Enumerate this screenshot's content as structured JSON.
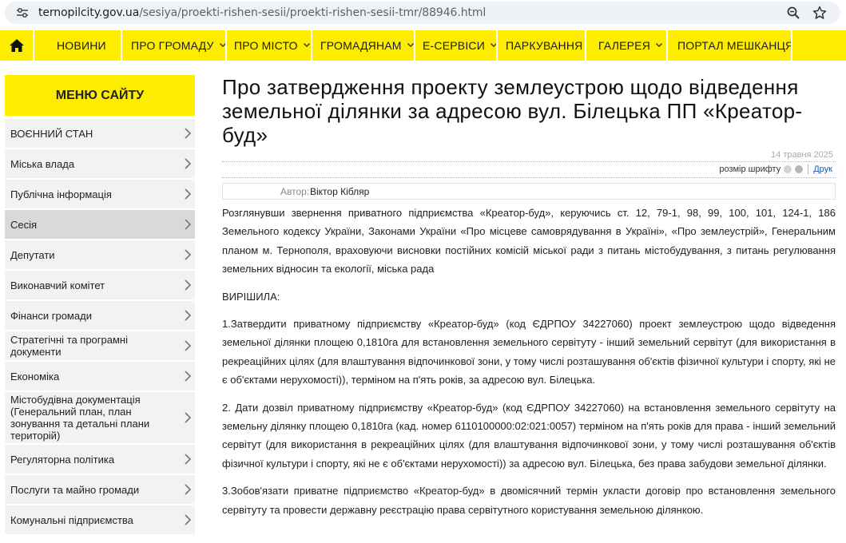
{
  "browser": {
    "url_domain": "ternopilcity.gov.ua",
    "url_path": "/sesiya/proekti-rishen-sesii/proekti-rishen-sesii-tmr/88946.html"
  },
  "nav": {
    "items": [
      {
        "label": "НОВИНИ",
        "has_dropdown": false
      },
      {
        "label": "ПРО ГРОМАДУ",
        "has_dropdown": true
      },
      {
        "label": "ПРО МІСТО",
        "has_dropdown": true
      },
      {
        "label": "ГРОМАДЯНАМ",
        "has_dropdown": true
      },
      {
        "label": "Е-СЕРВІСИ",
        "has_dropdown": true
      },
      {
        "label": "ПАРКУВАННЯ",
        "has_dropdown": false
      },
      {
        "label": "ГАЛЕРЕЯ",
        "has_dropdown": true
      },
      {
        "label": "ПОРТАЛ МЕШКАНЦЯ",
        "has_dropdown": false
      }
    ],
    "accent_color": "#ffed00"
  },
  "sidebar": {
    "heading": "МЕНЮ САЙТУ",
    "items": [
      {
        "label": "ВОЄННИЙ СТАН"
      },
      {
        "label": "Міська влада"
      },
      {
        "label": "Публічна інформація"
      },
      {
        "label": "Сесія",
        "active": true
      },
      {
        "label": "Депутати"
      },
      {
        "label": "Виконавчий комітет"
      },
      {
        "label": "Фінанси громади"
      },
      {
        "label": "Стратегічні та програмні документи"
      },
      {
        "label": "Економіка"
      },
      {
        "label": "Містобудівна документація (Генеральний план, план зонування та детальні плани територій)"
      },
      {
        "label": "Регуляторна політика"
      },
      {
        "label": "Послуги та майно громади"
      },
      {
        "label": "Комунальні підприємства"
      }
    ]
  },
  "article": {
    "title": "Про затвердження проекту землеустрою щодо відведення земельної ділянки за адресою вул. Білецька ПП «Креатор-буд»",
    "date": "14 травня 2025",
    "font_size_label": "розмір шрифту",
    "print_label": "Друк",
    "author_label": "Автор:",
    "author_name": "Віктор Кібляр",
    "paragraphs": [
      "Розглянувши звернення приватного підприємства «Креатор-буд», керуючись ст. 12, 79-1, 98, 99, 100, 101, 124-1, 186 Земельного кодексу України, Законами України «Про місцеве самоврядування в Україні», «Про землеустрій», Генеральним планом м. Тернополя, враховуючи висновки постійних комісій міської ради з питань містобудування, з питань регулювання земельних відносин та екології, міська рада",
      "ВИРІШИЛА:",
      "1.Затвердити приватному підприємству «Креатор-буд» (код ЄДРПОУ 34227060) проект землеустрою щодо відведення земельної ділянки площею 0,1810га для встановлення земельного сервітуту  - інший земельний сервітут (для використання в рекреаційних цілях (для влаштування відпочинкової зони, у тому числі розташування об'єктів фізичної культури і спорту, які не є об'єктами нерухомості)), терміном на п'ять років,  за адресою вул. Білецька.",
      "2. Дати дозвіл приватному підприємству «Креатор-буд» (код ЄДРПОУ 34227060) на встановлення земельного сервітуту на земельну ділянку площею 0,1810га (кад. номер 6110100000:02:021:0057) терміном на п'ять років для права - інший земельний сервітут (для використання в рекреаційних цілях (для влаштування відпочинкової зони, у тому числі розташування об'єктів фізичної культури і спорту, які не є об'єктами нерухомості))  за адресою вул. Білецька, без права забудови земельної ділянки.",
      "3.Зобов'язати приватне підприємство «Креатор-буд» в двомісячний термін укласти договір про встановлення земельного сервітуту та провести державну реєстрацію права сервітутного користування земельною ділянкою."
    ]
  }
}
